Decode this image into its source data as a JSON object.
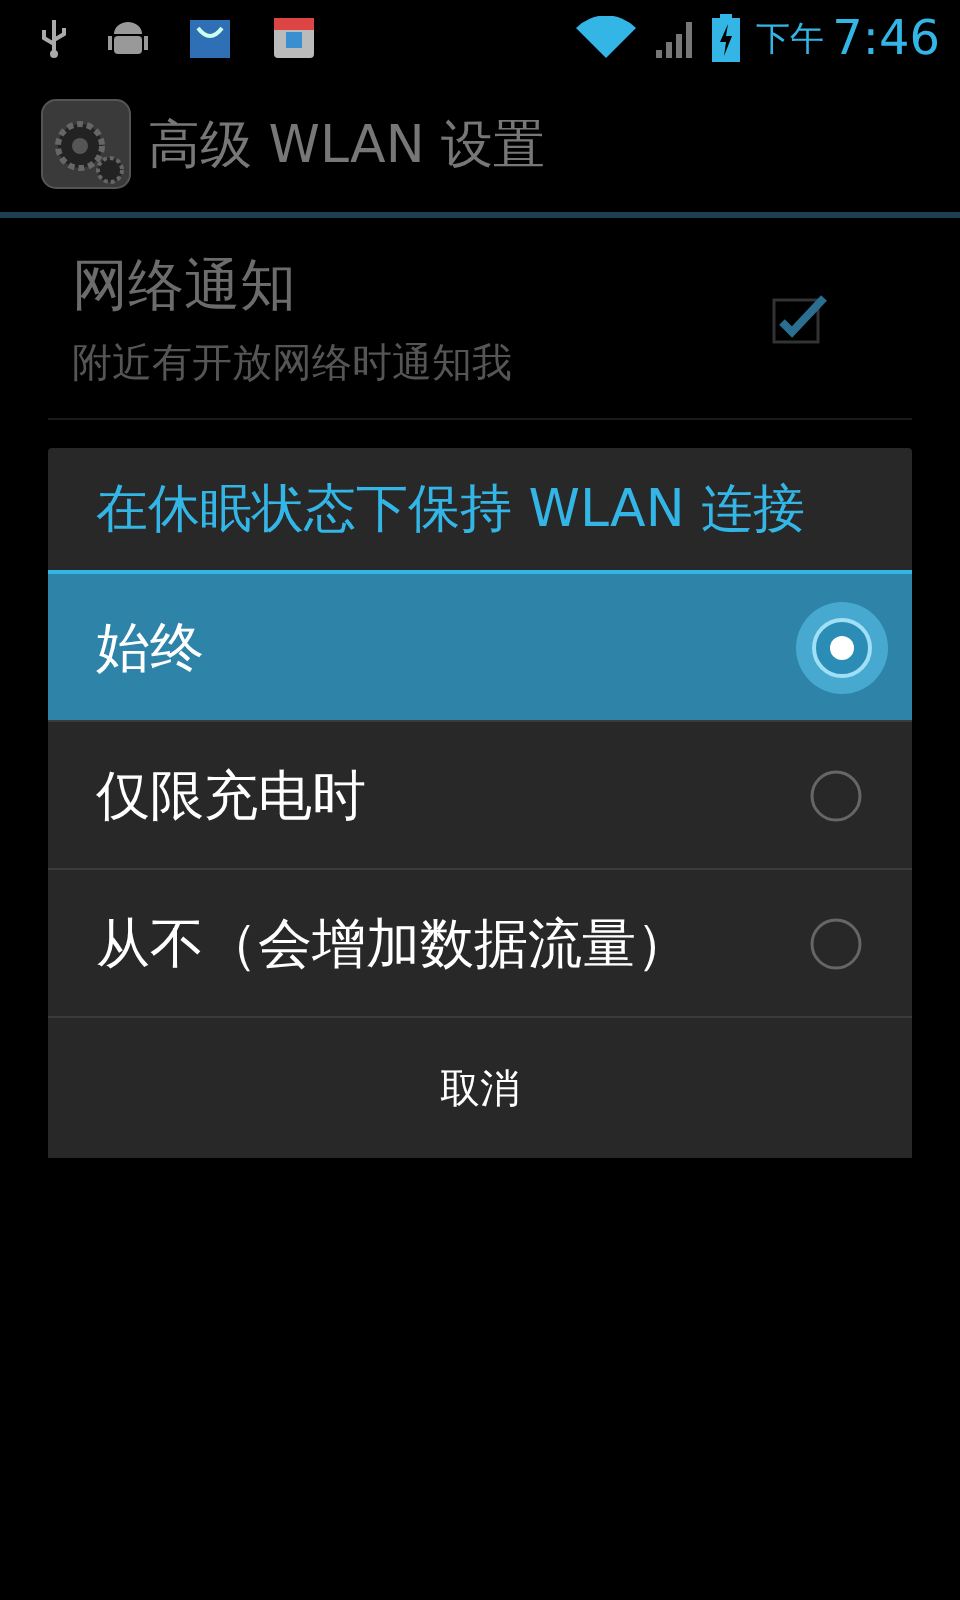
{
  "status_bar": {
    "period": "下午",
    "time": "7:46"
  },
  "action_bar": {
    "title": "高级 WLAN 设置"
  },
  "settings": [
    {
      "title": "网络通知",
      "summary": "附近有开放网络时通知我",
      "checked": true
    }
  ],
  "dialog": {
    "title": "在休眠状态下保持 WLAN 连接",
    "options": [
      {
        "label": "始终",
        "selected": true
      },
      {
        "label": "仅限充电时",
        "selected": false
      },
      {
        "label": "从不（会增加数据流量）",
        "selected": false
      }
    ],
    "button": "取消"
  }
}
